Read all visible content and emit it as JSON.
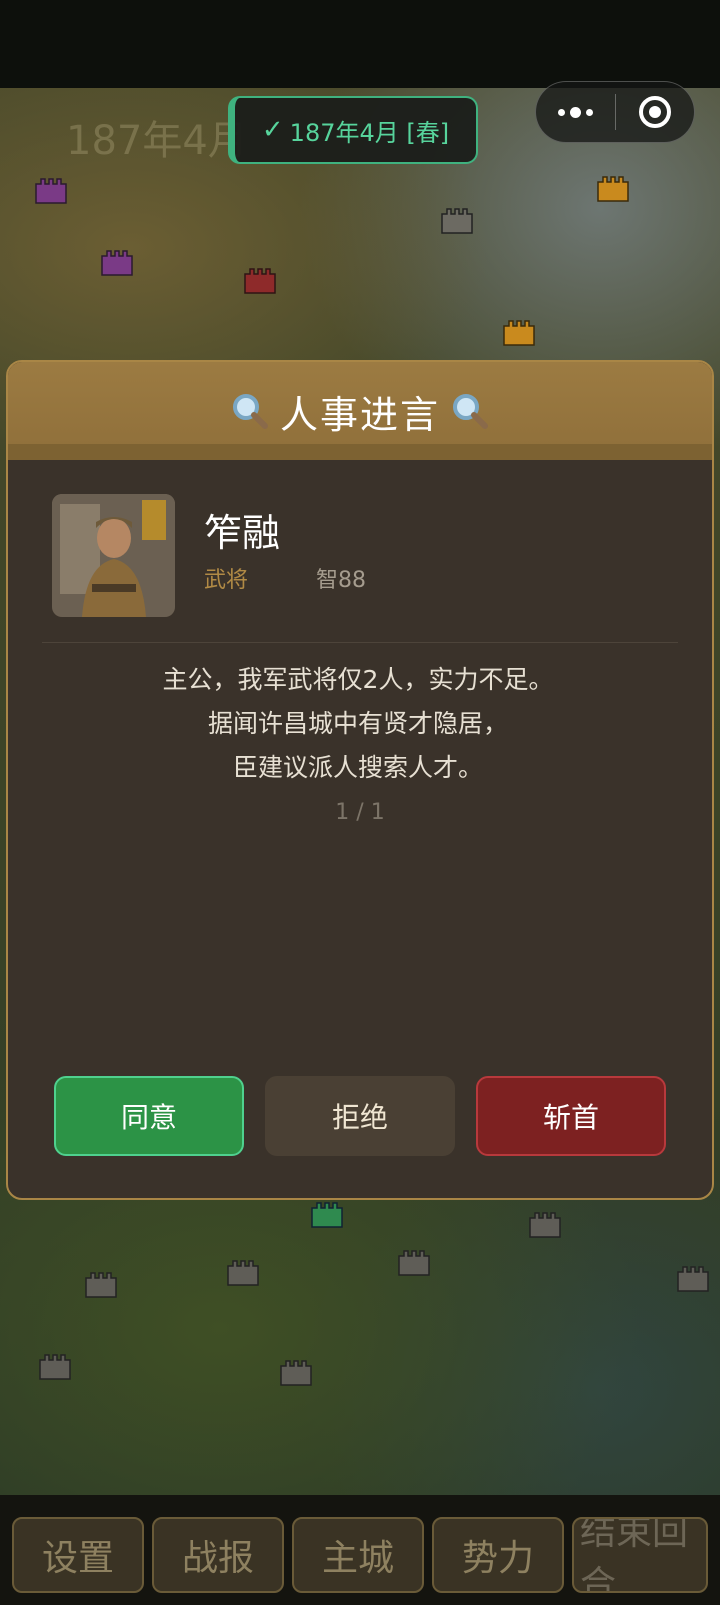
{
  "header": {
    "date_badge": "187年4月 [春]",
    "map_year_ghost": "187年4月",
    "capsule": {
      "more_icon": "more-dots-icon",
      "close_icon": "target-circle-icon"
    }
  },
  "dialog": {
    "title": "人事进言",
    "title_icon": "magnifier-icon",
    "advisor": {
      "name": "笮融",
      "role": "武将",
      "stat": "智88"
    },
    "message_lines": [
      "主公，我军武将仅2人，实力不足。",
      "据闻许昌城中有贤才隐居，",
      "臣建议派人搜索人才。"
    ],
    "pager": "1 / 1",
    "buttons": {
      "agree": "同意",
      "reject": "拒绝",
      "execute": "斩首"
    }
  },
  "bottom_nav": {
    "items": [
      "设置",
      "战报",
      "主城",
      "势力",
      "结束回合"
    ]
  },
  "colors": {
    "accent_green": "#3fb27f",
    "dialog_header": "#9c7b42",
    "dialog_body": "#3a322a",
    "agree": "#2c9346",
    "execute": "#7d2121",
    "role_text": "#b18a45"
  }
}
